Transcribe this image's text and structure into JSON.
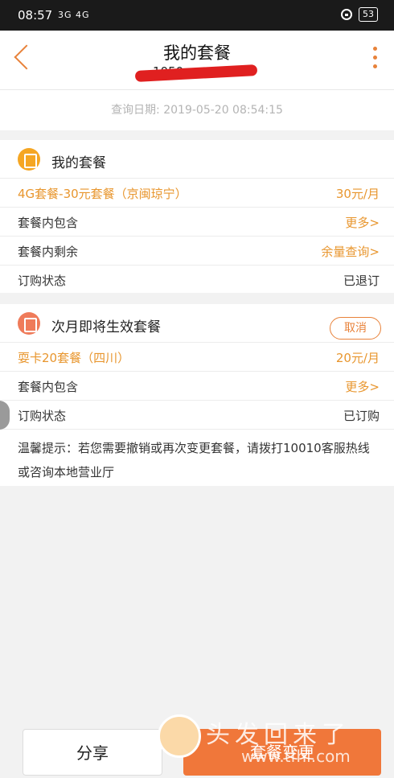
{
  "status_bar": {
    "time": "08:57",
    "signal": "3G 4G",
    "battery": "53"
  },
  "header": {
    "title": "我的套餐",
    "phone_partial": "1050"
  },
  "query": {
    "label": "查询日期:",
    "date": "2019-05-20 08:54:15"
  },
  "current_plan": {
    "title": "我的套餐",
    "plan_name": "4G套餐-30元套餐（京闽琼宁）",
    "price": "30元/月",
    "included_label": "套餐内包含",
    "included_link": "更多>",
    "remaining_label": "套餐内剩余",
    "remaining_link": "余量查询>",
    "order_status_label": "订购状态",
    "order_status_value": "已退订"
  },
  "next_plan": {
    "title": "次月即将生效套餐",
    "cancel_label": "取消",
    "plan_name": "耍卡20套餐（四川）",
    "price": "20元/月",
    "included_label": "套餐内包含",
    "included_link": "更多>",
    "order_status_label": "订购状态",
    "order_status_value": "已订购",
    "tip": "温馨提示：若您需要撤销或再次变更套餐，请拨打10010客服热线或咨询本地营业厅"
  },
  "footer": {
    "share_label": "分享",
    "change_label": "套餐变更"
  },
  "watermark": {
    "text": "头发回来了",
    "url": "www.tfhl.com"
  },
  "colors": {
    "accent": "#e8962e",
    "primary_button": "#f0773a"
  }
}
